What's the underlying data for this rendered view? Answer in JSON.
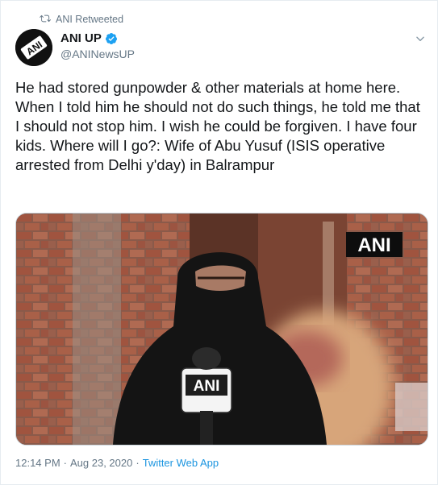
{
  "retweet": {
    "label": "ANI Retweeted",
    "icon": "retweet-icon"
  },
  "author": {
    "display_name": "ANI UP",
    "handle": "@ANINewsUP",
    "verified": true,
    "avatar_text": "ANI"
  },
  "tweet": {
    "text": "He had stored gunpowder & other materials at home here. When I told him he should not do such things, he told me that I should not stop him. I wish he could be forgiven. I have four kids. Where will I go?: Wife of Abu Yusuf (ISIS operative arrested from Delhi y'day) in Balrampur"
  },
  "media": {
    "watermark": "ANI",
    "mic_label": "ANI"
  },
  "meta": {
    "time": "12:14 PM",
    "separator": "·",
    "date": "Aug 23, 2020",
    "source": "Twitter Web App"
  },
  "colors": {
    "accent": "#1da1f2",
    "link": "#1b95e0",
    "secondary_text": "#657786"
  }
}
